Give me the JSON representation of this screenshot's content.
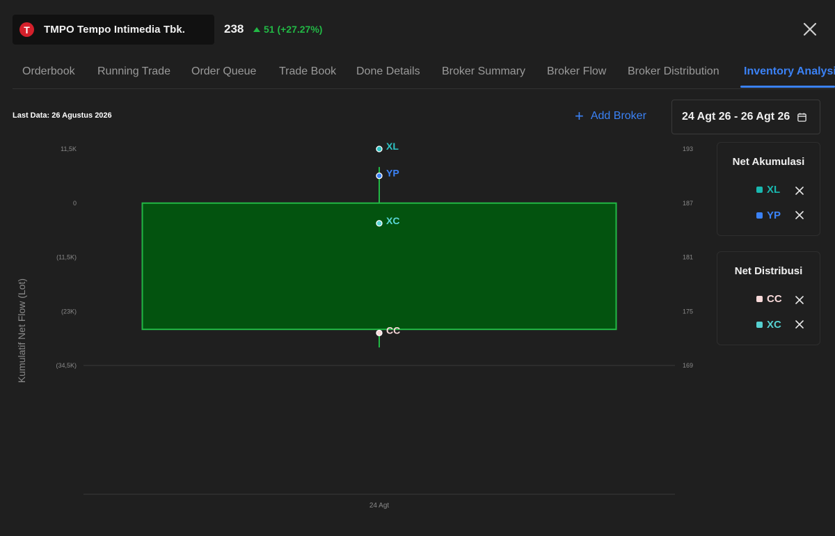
{
  "header": {
    "logo_letter": "T",
    "stock_name": "TMPO Tempo Intimedia Tbk.",
    "price": "238",
    "change": "51 (+27.27%)"
  },
  "tabs": [
    {
      "label": "Orderbook"
    },
    {
      "label": "Running Trade"
    },
    {
      "label": "Order Queue"
    },
    {
      "label": "Trade Book"
    },
    {
      "label": "Done Details"
    },
    {
      "label": "Broker Summary"
    },
    {
      "label": "Broker Flow"
    },
    {
      "label": "Broker Distribution"
    },
    {
      "label": "Inventory Analysis",
      "active": true
    }
  ],
  "toolbar": {
    "last_data_label": "Last Data:",
    "last_data_value": "26 Agustus 2026",
    "add_broker": "Add Broker",
    "date_range": "24 Agt 26 - 26 Agt 26"
  },
  "chart_data": {
    "type": "candlestick-with-broker-lines",
    "ylabel": "Kumulatif Net Flow (Lot)",
    "left_ticks": [
      "11,5K",
      "0",
      "(11,5K)",
      "(23K)",
      "(34,5K)"
    ],
    "left_tick_values": [
      11500,
      0,
      -11500,
      -23000,
      -34500
    ],
    "right_ticks": [
      "193",
      "187",
      "181",
      "175",
      "169"
    ],
    "right_tick_values": [
      193,
      187,
      181,
      175,
      169
    ],
    "x_labels": [
      "24 Agt"
    ],
    "candle": {
      "date": "24 Agt",
      "open": 187,
      "close": 173,
      "high": 191,
      "low": 171,
      "color": "#22b845",
      "fill": "#03530f"
    },
    "broker_points": [
      {
        "name": "XL",
        "value": 11500,
        "color": "#2ec4c4"
      },
      {
        "name": "YP",
        "value": 5800,
        "color": "#3b82f6"
      },
      {
        "name": "XC",
        "value": -4300,
        "color": "#5ad6d6"
      },
      {
        "name": "CC",
        "value": -27600,
        "color": "#f8d9d9"
      }
    ]
  },
  "legend": {
    "accumulation": {
      "title": "Net Akumulasi",
      "items": [
        {
          "name": "XL",
          "color": "#19b8b0"
        },
        {
          "name": "YP",
          "color": "#3b82f6"
        }
      ]
    },
    "distribution": {
      "title": "Net Distribusi",
      "items": [
        {
          "name": "CC",
          "color": "#f8d9d9"
        },
        {
          "name": "XC",
          "color": "#56d0d0"
        }
      ]
    }
  }
}
